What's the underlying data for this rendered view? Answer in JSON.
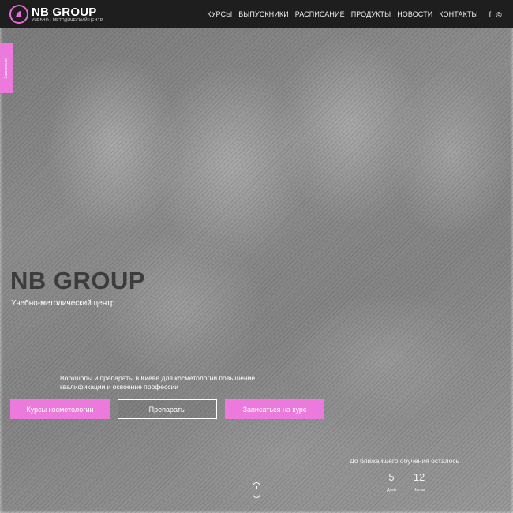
{
  "brand": {
    "title": "NB GROUP",
    "subtitle": "УЧЕБНО - МЕТОДИЧЕСКИЙ ЦЕНТР",
    "accent_color": "#ec7adc"
  },
  "nav": {
    "items": [
      {
        "label": "КУРСЫ"
      },
      {
        "label": "ВЫПУСКНИКИ"
      },
      {
        "label": "РАСПИСАНИЕ"
      },
      {
        "label": "ПРОДУКТЫ"
      },
      {
        "label": "НОВОСТИ"
      },
      {
        "label": "КОНТАКТЫ"
      }
    ],
    "social": [
      {
        "icon": "facebook-icon",
        "glyph": "f"
      },
      {
        "icon": "instagram-icon",
        "glyph": "◎"
      }
    ]
  },
  "side_tab": {
    "label": "Записаться"
  },
  "hero": {
    "title": "NB GROUP",
    "subtitle": "Учебно-методический центр",
    "description": "Воркшопы и препараты в Киеве для косметологии повышение квалификации и освоение профессии"
  },
  "buttons": {
    "courses": "Курсы косметологии",
    "products": "Препараты",
    "signup": "Записаться на курс"
  },
  "countdown": {
    "label": "До ближайшего обучения осталось",
    "days_value": "5",
    "days_unit": "Дней",
    "hours_value": "12",
    "hours_unit": "Часов"
  }
}
